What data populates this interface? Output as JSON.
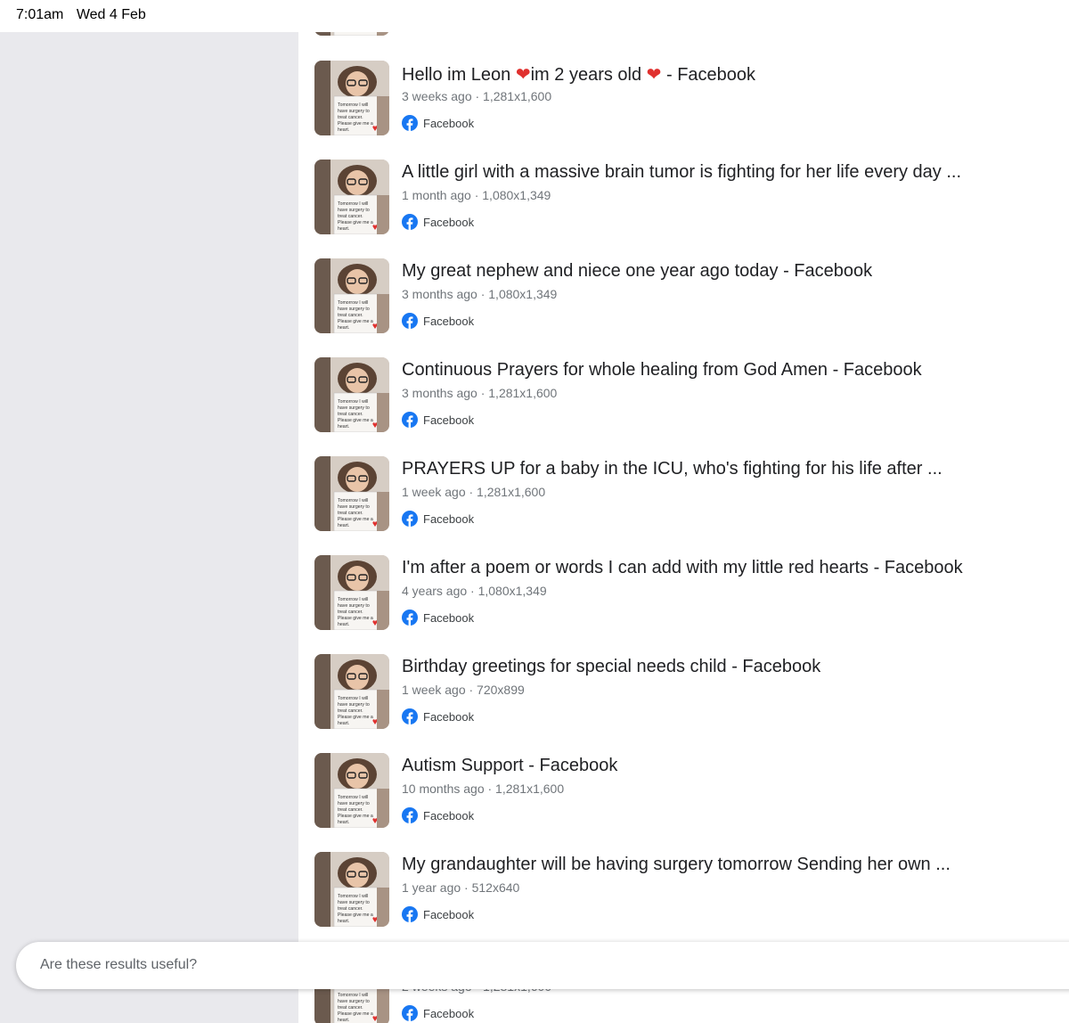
{
  "status_bar": {
    "time": "7:01am",
    "date": "Wed 4 Feb"
  },
  "thumbnail": {
    "sign_lines": [
      "Tomorrow I will",
      "have surgery to",
      "treat cancer.",
      "Please give me a",
      "heart."
    ]
  },
  "results": [
    {
      "title": "Hello im Leon ❤️im 2 years old ❤️ - Facebook",
      "meta": "3 weeks ago · 1,281x1,600",
      "source": "Facebook"
    },
    {
      "title": "A little girl with a massive brain tumor is fighting for her life every day ...",
      "meta": "1 month ago · 1,080x1,349",
      "source": "Facebook"
    },
    {
      "title": "My great nephew and niece one year ago today - Facebook",
      "meta": "3 months ago · 1,080x1,349",
      "source": "Facebook"
    },
    {
      "title": "Continuous Prayers for whole healing from God Amen - Facebook",
      "meta": "3 months ago · 1,281x1,600",
      "source": "Facebook"
    },
    {
      "title": "PRAYERS UP for a baby in the ICU, who's fighting for his life after ...",
      "meta": "1 week ago · 1,281x1,600",
      "source": "Facebook"
    },
    {
      "title": "I'm after a poem or words I can add with my little red hearts - Facebook",
      "meta": "4 years ago · 1,080x1,349",
      "source": "Facebook"
    },
    {
      "title": "Birthday greetings for special needs child - Facebook",
      "meta": "1 week ago · 720x899",
      "source": "Facebook"
    },
    {
      "title": "Autism Support - Facebook",
      "meta": "10 months ago · 1,281x1,600",
      "source": "Facebook"
    },
    {
      "title": "My grandaughter will be having surgery tomorrow Sending her own ...",
      "meta": "1 year ago · 512x640",
      "source": "Facebook"
    },
    {
      "title": "",
      "meta": "2 weeks ago · 1,281x1,600",
      "source": "Facebook"
    }
  ],
  "feedback": {
    "prompt": "Are these results useful?"
  },
  "colors": {
    "facebook_blue": "#1877f2",
    "sidebar_bg": "#e9e9ed",
    "heart_red": "#e0302e"
  }
}
